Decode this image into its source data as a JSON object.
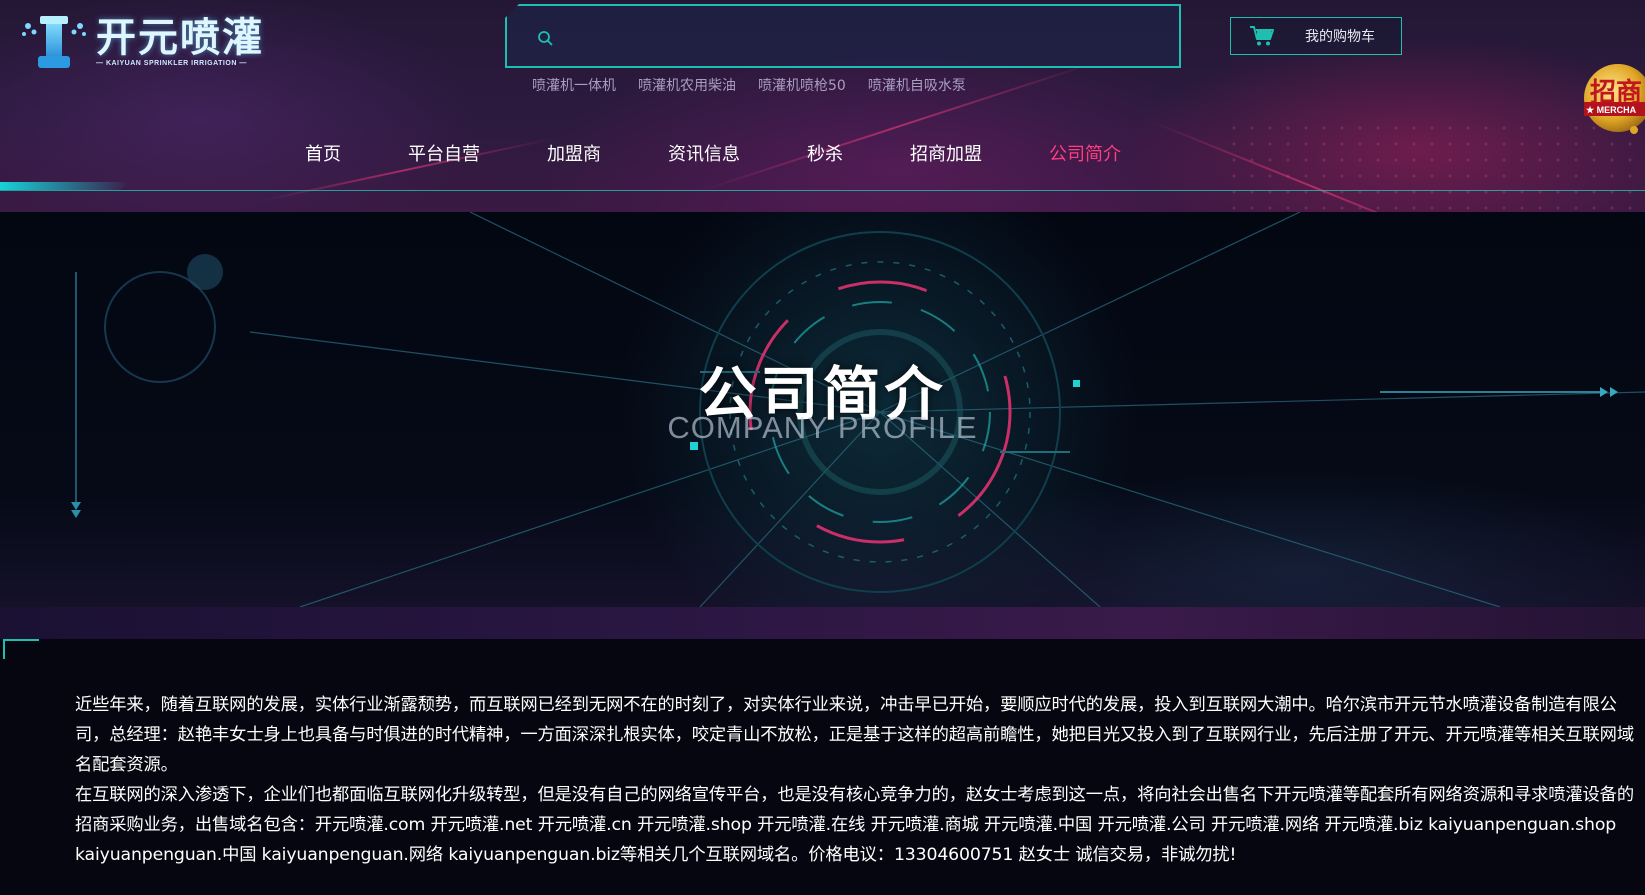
{
  "logo": {
    "title": "开元喷灌",
    "subtitle": "— KAIYUAN SPRINKLER IRRIGATION —"
  },
  "search": {
    "value": "",
    "placeholder": "",
    "button_label": "搜索",
    "hot_words": [
      "喷灌机一体机",
      "喷灌机农用柴油",
      "喷灌机喷枪50",
      "喷灌机自吸水泵"
    ]
  },
  "cart": {
    "label": "我的购物车"
  },
  "merchant_badge": {
    "label": "招商",
    "sub": "★ MERCHA"
  },
  "nav": {
    "items": [
      {
        "label": "首页",
        "active": false
      },
      {
        "label": "平台自营",
        "active": false
      },
      {
        "label": "加盟商",
        "active": false
      },
      {
        "label": "资讯信息",
        "active": false
      },
      {
        "label": "秒杀",
        "active": false
      },
      {
        "label": "招商加盟",
        "active": false
      },
      {
        "label": "公司简介",
        "active": true
      }
    ]
  },
  "banner": {
    "title": "公司简介",
    "subtitle": "COMPANY PROFILE"
  },
  "content": {
    "paragraphs": [
      "近些年来，随着互联网的发展，实体行业渐露颓势，而互联网已经到无网不在的时刻了，对实体行业来说，冲击早已开始，要顺应时代的发展，投入到互联网大潮中。哈尔滨市开元节水喷灌设备制造有限公司，总经理：赵艳丰女士身上也具备与时俱进的时代精神，一方面深深扎根实体，咬定青山不放松，正是基于这样的超高前瞻性，她把目光又投入到了互联网行业，先后注册了开元、开元喷灌等相关互联网域名配套资源。",
      "在互联网的深入渗透下，企业们也都面临互联网化升级转型，但是没有自己的网络宣传平台，也是没有核心竞争力的，赵女士考虑到这一点，将向社会出售名下开元喷灌等配套所有网络资源和寻求喷灌设备的招商采购业务，出售域名包含：开元喷灌.com 开元喷灌.net 开元喷灌.cn 开元喷灌.shop 开元喷灌.在线 开元喷灌.商城  开元喷灌.中国 开元喷灌.公司 开元喷灌.网络 开元喷灌.biz kaiyuanpenguan.shop kaiyuanpenguan.中国  kaiyuanpenguan.网络 kaiyuanpenguan.biz等相关几个互联网域名。价格电议：13304600751 赵女士 诚信交易，非诚勿扰!"
    ]
  },
  "colors": {
    "accent_teal": "#1fbfb0",
    "active_pink": "#ff3d7f",
    "hot_word_gray": "#a99ec0"
  }
}
